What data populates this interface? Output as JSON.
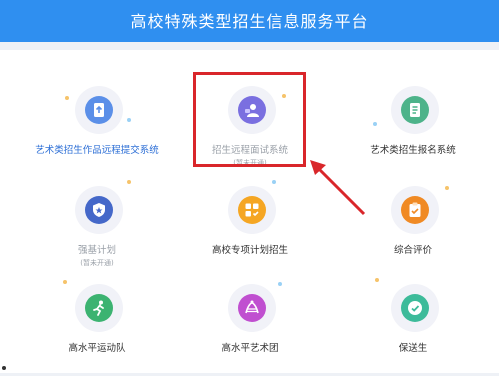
{
  "header": {
    "title": "高校特殊类型招生信息服务平台"
  },
  "tiles": [
    {
      "label": "艺术类招生作品远程提交系统",
      "status": "",
      "icon": "upload-document-icon",
      "icon_color": "#5b8fe8"
    },
    {
      "label": "招生远程面试系统",
      "status": "(暂未开通)",
      "icon": "interview-person-icon",
      "icon_color": "#7a6fe0"
    },
    {
      "label": "艺术类招生报名系统",
      "status": "",
      "icon": "registration-form-icon",
      "icon_color": "#4db38a"
    },
    {
      "label": "强基计划",
      "status": "(暂未开通)",
      "icon": "shield-badge-icon",
      "icon_color": "#4568c9"
    },
    {
      "label": "高校专项计划招生",
      "status": "",
      "icon": "grid-check-icon",
      "icon_color": "#f5a623"
    },
    {
      "label": "综合评价",
      "status": "",
      "icon": "clipboard-check-icon",
      "icon_color": "#f08a24"
    },
    {
      "label": "高水平运动队",
      "status": "",
      "icon": "athlete-running-icon",
      "icon_color": "#3cb371"
    },
    {
      "label": "高水平艺术团",
      "status": "",
      "icon": "art-troupe-icon",
      "icon_color": "#c04fd0"
    },
    {
      "label": "保送生",
      "status": "",
      "icon": "guarantee-badge-icon",
      "icon_color": "#3dbb9a"
    }
  ],
  "accent": "#2f8ff0",
  "highlight_color": "#d9262a"
}
